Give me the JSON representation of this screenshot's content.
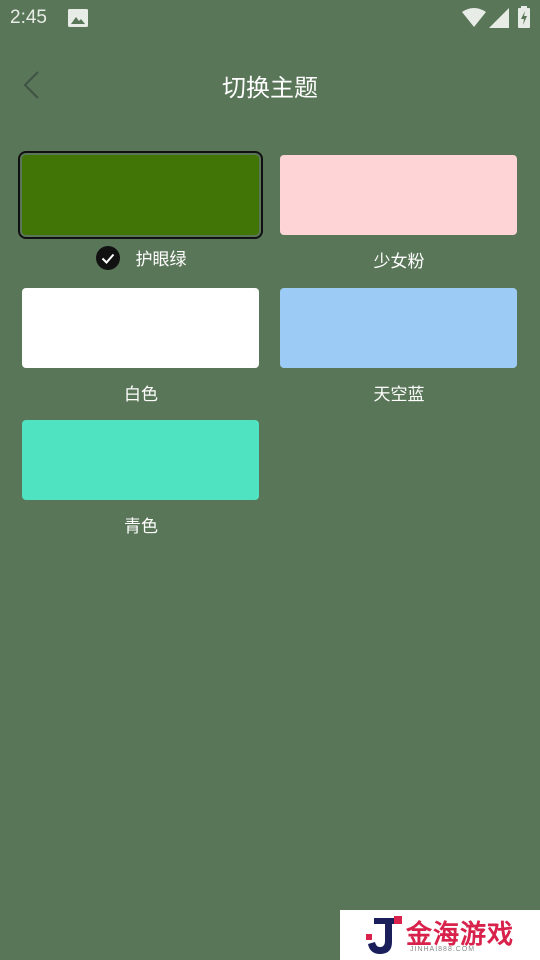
{
  "status_bar": {
    "time": "2:45"
  },
  "header": {
    "title": "切换主题"
  },
  "themes": [
    {
      "name": "护眼绿",
      "color": "#417505",
      "selected": true
    },
    {
      "name": "少女粉",
      "color": "#ffd4d6",
      "selected": false
    },
    {
      "name": "白色",
      "color": "#ffffff",
      "selected": false
    },
    {
      "name": "天空蓝",
      "color": "#9ccbf5",
      "selected": false
    },
    {
      "name": "青色",
      "color": "#50e3c2",
      "selected": false
    }
  ],
  "watermark": {
    "brand": "金海游戏",
    "site": "JINHAI888.COM"
  },
  "colors": {
    "background": "#5a7658",
    "selection_border": "#111111"
  }
}
